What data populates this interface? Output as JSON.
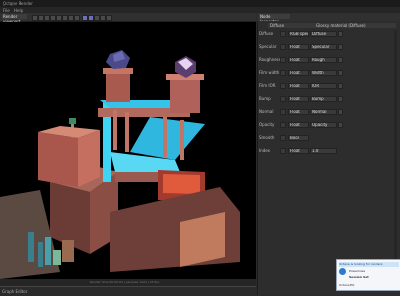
{
  "window": {
    "title": "Octane Render"
  },
  "menu": [
    "File",
    "Help"
  ],
  "viewport": {
    "tab_label": "Render viewport",
    "status_text": "Render time 00:00:04 | samples 1024 | 23 fps"
  },
  "graph": {
    "tab_label": "Graph Editor"
  },
  "node_inspector": {
    "tab_label": "Node Inspector",
    "material_label": "Diffuse",
    "material_type": "Glossy material (Diffuse)",
    "params": [
      {
        "label": "Diffuse",
        "mode": "RGB spectrum",
        "value": "Diffuse"
      },
      {
        "label": "Specular",
        "mode": "Float",
        "value": "Specular"
      },
      {
        "label": "Roughness",
        "mode": "Float",
        "value": "Rough"
      },
      {
        "label": "Film width",
        "mode": "Float",
        "value": "Width"
      },
      {
        "label": "Film IOR",
        "mode": "Float",
        "value": "IOR"
      },
      {
        "label": "Bump",
        "mode": "Float",
        "value": "Bump"
      },
      {
        "label": "Normal",
        "mode": "Float",
        "value": "Normal"
      },
      {
        "label": "Opacity",
        "mode": "Float",
        "value": "Opacity"
      },
      {
        "label": "Smooth",
        "mode": "Bool",
        "value": ""
      },
      {
        "label": "Index",
        "mode": "Float",
        "value": "1.0"
      }
    ]
  },
  "popup": {
    "banner": "Octane is looking for renders",
    "line1": "Powerlines",
    "line2": "Session Set",
    "line3": "OctaneHQ"
  },
  "colors": {
    "accent": "#6d6fb8",
    "water": "#3fd4f4",
    "stone": "#b36a60"
  }
}
